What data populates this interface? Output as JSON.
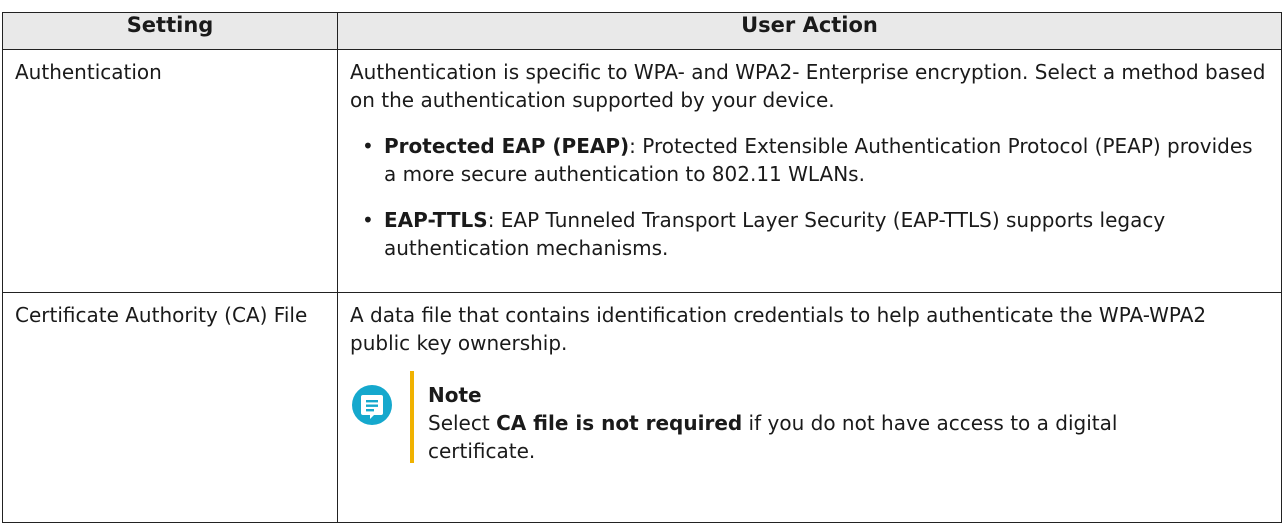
{
  "table": {
    "headers": {
      "setting": "Setting",
      "user_action": "User Action"
    },
    "rows": [
      {
        "setting": "Authentication",
        "action_intro": "Authentication is specific to WPA- and WPA2- Enterprise encryption. Select a method based on the authentication supported by your device.",
        "bullets": [
          {
            "term": "Protected EAP (PEAP)",
            "text": ": Protected Extensible Authentication Protocol (PEAP) provides a more secure authentication to 802.11 WLANs."
          },
          {
            "term": "EAP-TTLS",
            "text": ": EAP Tunneled Transport Layer Security (EAP-TTLS) supports legacy authentication mechanisms."
          }
        ]
      },
      {
        "setting": "Certificate Authority (CA) File",
        "action_intro": "A data file that contains identification credentials to help authenticate the WPA-WPA2 public key ownership.",
        "note": {
          "icon": "note-icon",
          "title": "Note",
          "text_before": "Select ",
          "text_bold": "CA file is not required",
          "text_after": " if you do not have access to a digital certificate."
        }
      }
    ]
  },
  "colors": {
    "note_icon": "#15a8cd",
    "note_bar": "#f0b200",
    "header_bg": "#e9e9e9",
    "border": "#222222"
  }
}
